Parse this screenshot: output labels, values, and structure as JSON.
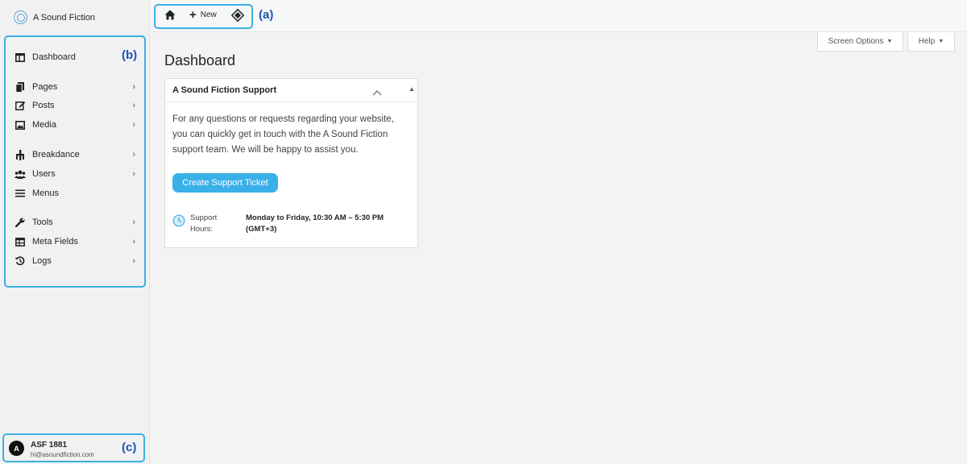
{
  "brand": {
    "name": "A Sound Fiction"
  },
  "annotations": {
    "a": "(a)",
    "b": "(b)",
    "c": "(c)"
  },
  "topbar": {
    "home_icon": "home-icon",
    "new_label": "New",
    "plugin_icon": "diamond-icon"
  },
  "sidebar": {
    "items": [
      {
        "label": "Dashboard",
        "icon": "dashboard-icon",
        "has_chevron": false
      },
      {
        "label": "Pages",
        "icon": "pages-icon",
        "has_chevron": true
      },
      {
        "label": "Posts",
        "icon": "posts-icon",
        "has_chevron": true
      },
      {
        "label": "Media",
        "icon": "media-icon",
        "has_chevron": true
      },
      {
        "label": "Breakdance",
        "icon": "breakdance-icon",
        "has_chevron": true
      },
      {
        "label": "Users",
        "icon": "users-icon",
        "has_chevron": true
      },
      {
        "label": "Menus",
        "icon": "menus-icon",
        "has_chevron": false
      },
      {
        "label": "Tools",
        "icon": "tools-icon",
        "has_chevron": true
      },
      {
        "label": "Meta Fields",
        "icon": "meta-fields-icon",
        "has_chevron": true
      },
      {
        "label": "Logs",
        "icon": "logs-icon",
        "has_chevron": true
      }
    ],
    "chevron": "›"
  },
  "user": {
    "avatar_letter": "A",
    "name": "ASF 1881",
    "email": "hi@asoundfiction.com"
  },
  "screen_options": {
    "label": "Screen Options",
    "caret": "▼"
  },
  "help": {
    "label": "Help",
    "caret": "▼"
  },
  "page": {
    "title": "Dashboard"
  },
  "widget": {
    "title": "A Sound Fiction Support",
    "caret": "▲",
    "text": "For any questions or requests regarding your website, you can quickly get in touch with the A Sound Fiction support team. We will be happy to assist you.",
    "button_label": "Create Support Ticket",
    "hours_label": "Support Hours:",
    "hours_value": "Monday to Friday, 10:30 AM – 5:30 PM (GMT+3)"
  },
  "colors": {
    "accent": "#3ab0e2",
    "button": "#3ab0e8",
    "annotation": "#1a55b4"
  }
}
